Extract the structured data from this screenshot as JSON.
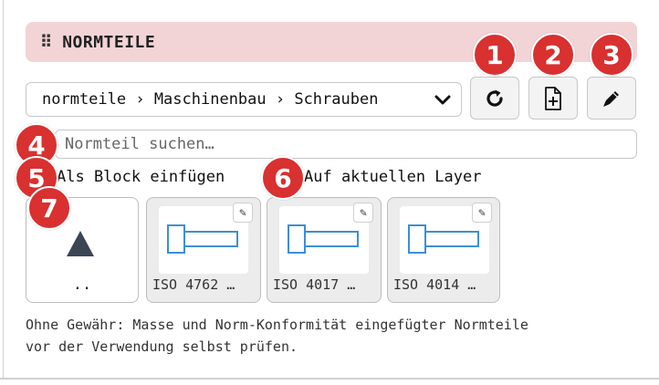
{
  "panel": {
    "title": "NORMTEILE",
    "grip_glyph": "⠿"
  },
  "path": {
    "value": "normteile › Maschinenbau › Schrauben"
  },
  "toolbar": {
    "buttons": [
      {
        "name": "refresh",
        "icon": "refresh-icon"
      },
      {
        "name": "new-file",
        "icon": "file-plus-icon"
      },
      {
        "name": "edit",
        "icon": "pencil-icon"
      }
    ]
  },
  "search": {
    "placeholder": "Normteil suchen…",
    "value": ""
  },
  "options": {
    "as_block_label": "Als Block einfügen",
    "current_layer_label": "Auf aktuellen Layer"
  },
  "grid": {
    "up_label": "..",
    "edit_glyph": "✎",
    "parts": [
      {
        "label": "ISO 4762 …"
      },
      {
        "label": "ISO 4017 …"
      },
      {
        "label": "ISO 4014 …"
      }
    ]
  },
  "note": {
    "line1": "Ohne Gewähr: Masse und Norm-Konformität eingefügter Normteile",
    "line2": "vor der Verwendung selbst prüfen."
  },
  "markers": [
    "1",
    "2",
    "3",
    "4",
    "5",
    "6",
    "7"
  ],
  "colors": {
    "header_bg": "#f2d4d6",
    "marker": "#d93030",
    "bolt_stroke": "#3d8fd6"
  }
}
